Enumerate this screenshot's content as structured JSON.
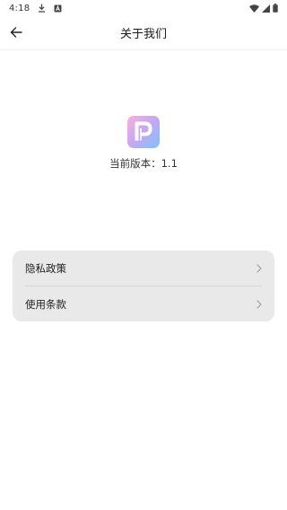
{
  "status_bar": {
    "time": "4:18",
    "icons": [
      "download-icon",
      "notification-a-icon",
      "wifi-icon",
      "signal-icon",
      "battery-icon"
    ]
  },
  "app_bar": {
    "title": "关于我们",
    "back_icon": "arrow-left-icon"
  },
  "about": {
    "logo_icon": "app-logo-p-icon",
    "version_text": "当前版本：1.1"
  },
  "menu": {
    "items": [
      {
        "label": "隐私政策",
        "icon": "chevron-right-icon"
      },
      {
        "label": "使用条款",
        "icon": "chevron-right-icon"
      }
    ]
  },
  "colors": {
    "background": "#ffffff",
    "card": "#e9e9e9",
    "text": "#1a1a1a",
    "logo_gradient_start": "#f3a9d8",
    "logo_gradient_end": "#7fc3f7"
  }
}
